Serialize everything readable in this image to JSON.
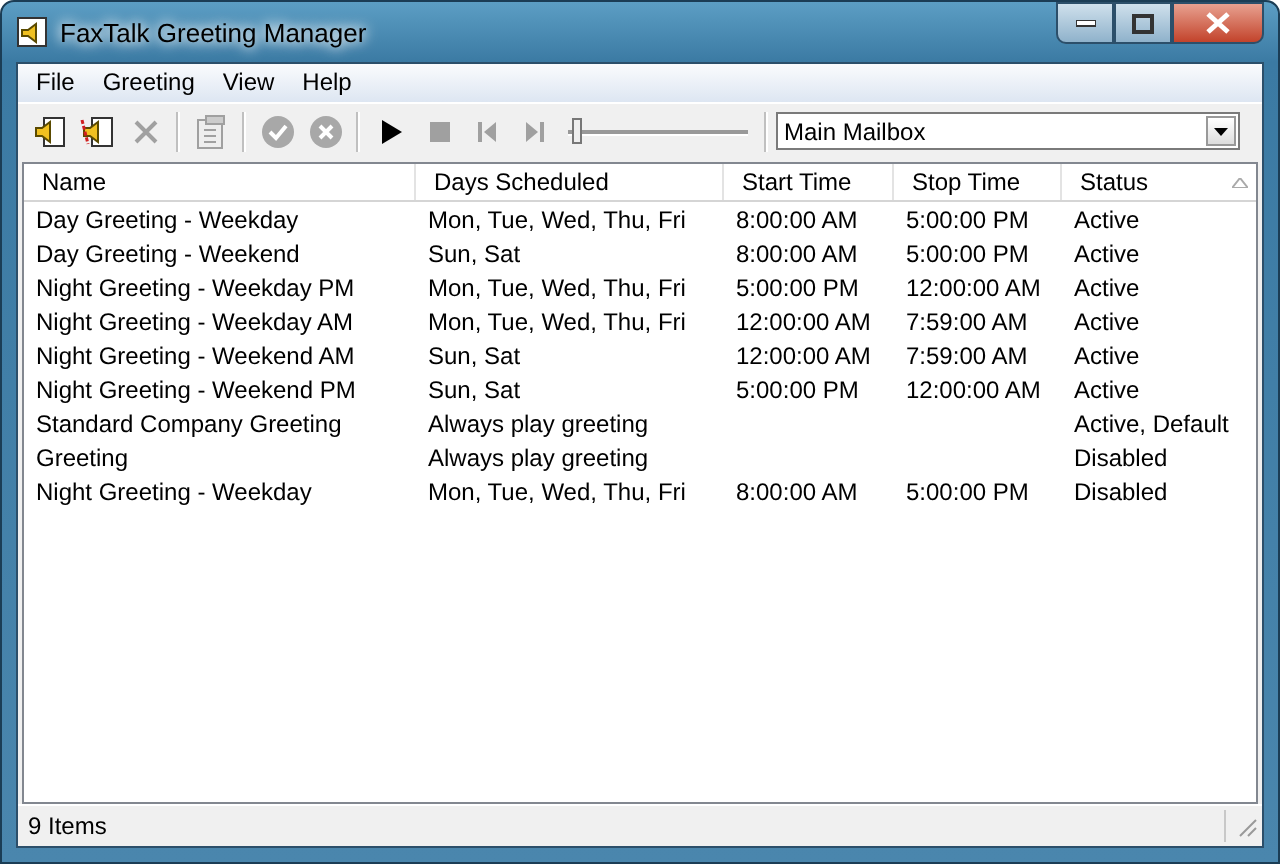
{
  "window": {
    "title": "FaxTalk Greeting Manager"
  },
  "menu": [
    "File",
    "Greeting",
    "View",
    "Help"
  ],
  "toolbar": [
    {
      "kind": "add",
      "disabled": false
    },
    {
      "kind": "edit",
      "disabled": false
    },
    {
      "kind": "delete",
      "disabled": true
    },
    {
      "kind": "separator"
    },
    {
      "kind": "properties",
      "disabled": true
    },
    {
      "kind": "separator"
    },
    {
      "kind": "enable",
      "disabled": true
    },
    {
      "kind": "disable",
      "disabled": true
    },
    {
      "kind": "separator"
    },
    {
      "kind": "play",
      "disabled": false
    },
    {
      "kind": "stop",
      "disabled": true
    },
    {
      "kind": "previous",
      "disabled": true
    },
    {
      "kind": "next",
      "disabled": true
    },
    {
      "kind": "slider",
      "level": 0.02
    },
    {
      "kind": "separator"
    }
  ],
  "mailbox": {
    "value": "Main Mailbox"
  },
  "table": {
    "columns": [
      {
        "label": "Name",
        "sorted": false
      },
      {
        "label": "Days Scheduled",
        "sorted": false
      },
      {
        "label": "Start Time",
        "sorted": false
      },
      {
        "label": "Stop Time",
        "sorted": false
      },
      {
        "label": "Status",
        "sorted": true
      }
    ],
    "rows": [
      [
        "Day Greeting - Weekday",
        "Mon, Tue, Wed, Thu, Fri",
        "8:00:00 AM",
        "5:00:00 PM",
        "Active"
      ],
      [
        "Day Greeting - Weekend",
        "Sun, Sat",
        "8:00:00 AM",
        "5:00:00 PM",
        "Active"
      ],
      [
        "Night Greeting - Weekday PM",
        "Mon, Tue, Wed, Thu, Fri",
        "5:00:00 PM",
        "12:00:00 AM",
        "Active"
      ],
      [
        "Night Greeting - Weekday AM",
        "Mon, Tue, Wed, Thu, Fri",
        "12:00:00 AM",
        "7:59:00 AM",
        "Active"
      ],
      [
        "Night Greeting - Weekend AM",
        "Sun, Sat",
        "12:00:00 AM",
        "7:59:00 AM",
        "Active"
      ],
      [
        "Night Greeting - Weekend PM",
        "Sun, Sat",
        "5:00:00 PM",
        "12:00:00 AM",
        "Active"
      ],
      [
        "Standard Company Greeting",
        "Always play greeting",
        "",
        "",
        "Active, Default"
      ],
      [
        "Greeting",
        "Always play greeting",
        "",
        "",
        "Disabled"
      ],
      [
        "Night Greeting - Weekday",
        "Mon, Tue, Wed, Thu, Fri",
        "8:00:00 AM",
        "5:00:00 PM",
        "Disabled"
      ]
    ]
  },
  "status_bar": {
    "text": "9 Items"
  }
}
